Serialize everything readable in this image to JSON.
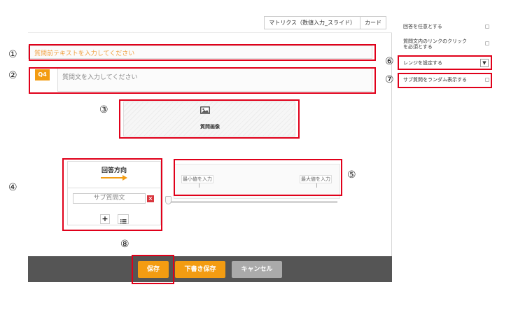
{
  "editor": {
    "type_tabs": [
      "マトリクス（数値入力_スライド）",
      "カード"
    ],
    "pre_text_placeholder": "質問前テキストを入力してください",
    "question_number": "Q4",
    "question_placeholder": "質問文を入力してください",
    "image_label": "質問画像",
    "direction_title": "回答方向",
    "sub_question_placeholder": "サブ質問文",
    "delete_symbol": "×",
    "add_symbol": "+",
    "min_placeholder": "最小値を入力",
    "max_placeholder": "最大値を入力"
  },
  "footer": {
    "save": "保存",
    "draft": "下書き保存",
    "cancel": "キャンセル"
  },
  "settings": {
    "optional": "回答を任意とする",
    "link_click_line1": "質問文内のリンクのクリック",
    "link_click_line2": "を必須とする",
    "range": "レンジを設定する",
    "random_sub": "サブ質問をランダム表示する"
  },
  "markers": [
    "①",
    "②",
    "③",
    "④",
    "⑤",
    "⑥",
    "⑦",
    "⑧"
  ],
  "colors": {
    "accent": "#f39c12",
    "highlight": "#e0001a",
    "footer": "#555555",
    "cancel": "#aaaaaa",
    "delete": "#d9363e"
  }
}
